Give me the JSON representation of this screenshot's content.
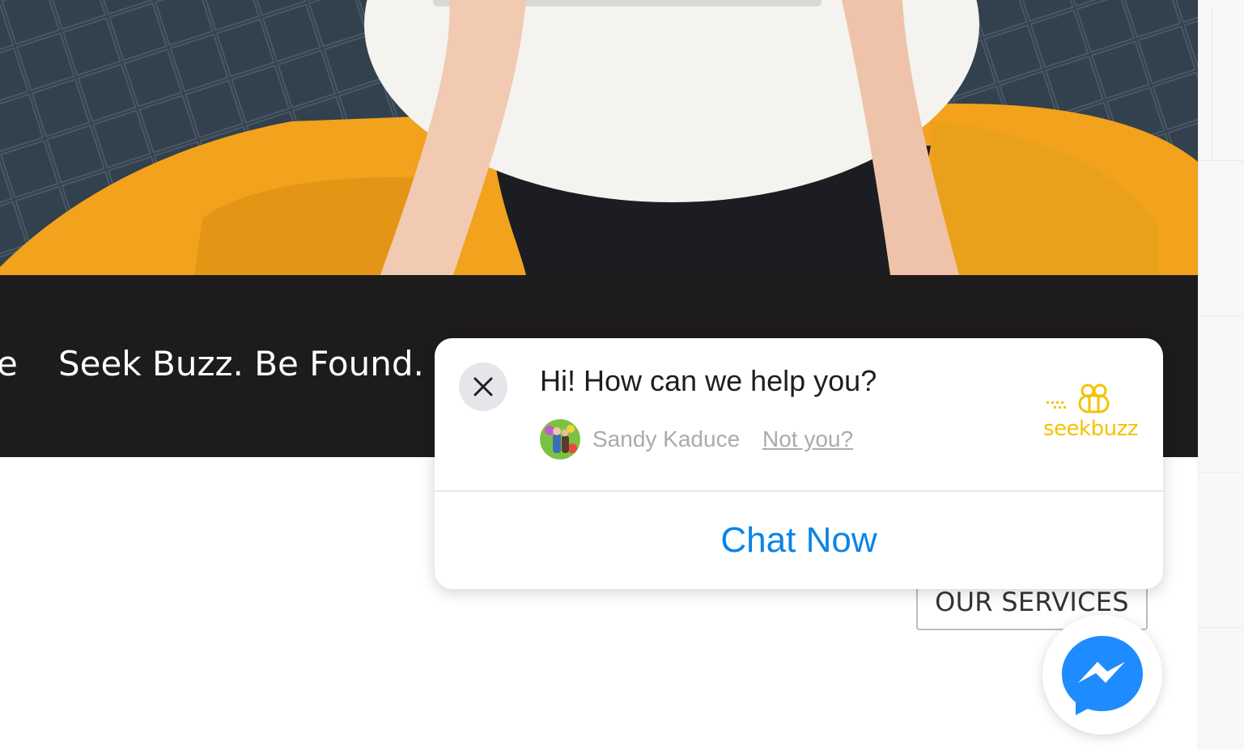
{
  "banner": {
    "fragment": "e",
    "tagline": "Seek Buzz. Be Found."
  },
  "services_button": {
    "label": "OUR SERVICES"
  },
  "chat_popup": {
    "greeting": "Hi! How can we help you?",
    "agent_name": "Sandy Kaduce",
    "not_you": "Not you?",
    "brand_name": "seekbuzz",
    "cta": "Chat Now",
    "close_icon": "close-icon",
    "link_color": "#0a84e8",
    "brand_color": "#f5c200"
  },
  "messenger": {
    "icon": "messenger-icon",
    "color": "#1e8cff"
  },
  "hero": {
    "accent": "#f5a623",
    "floor": "#2f3a47"
  }
}
